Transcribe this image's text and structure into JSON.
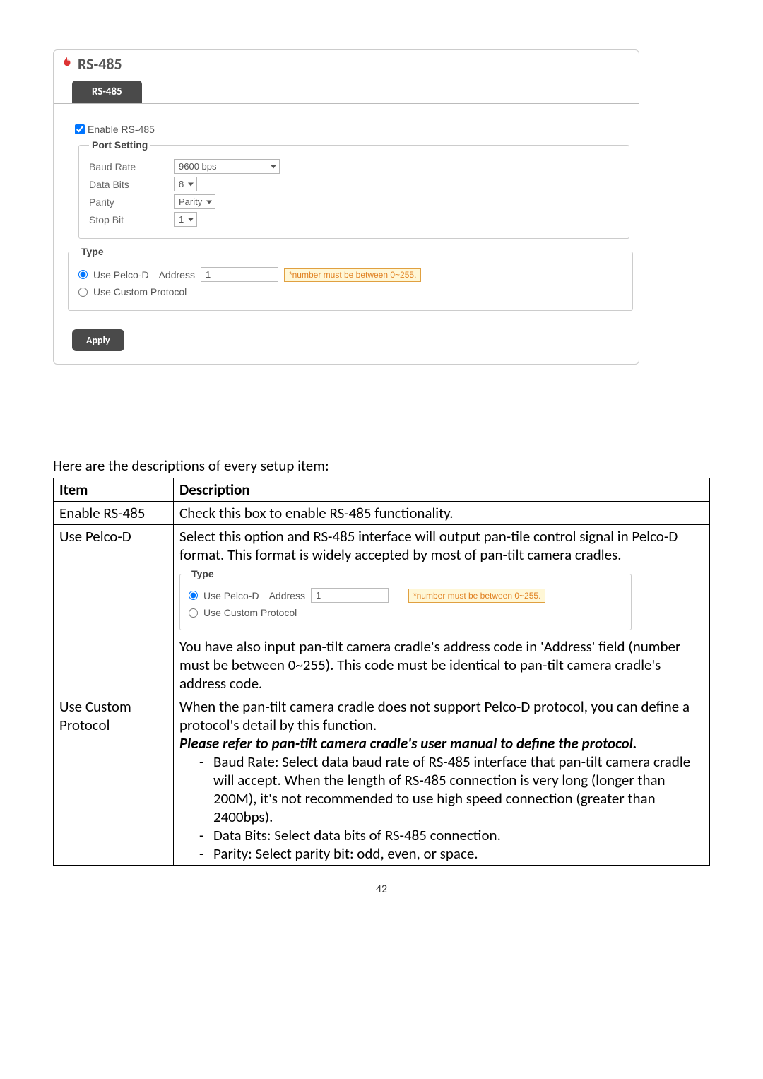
{
  "panel": {
    "title": "RS-485",
    "tab": "RS-485",
    "enable_label": "Enable RS-485",
    "enable_checked": true,
    "port_setting_legend": "Port Setting",
    "baud_rate_label": "Baud Rate",
    "baud_rate_value": "9600 bps",
    "data_bits_label": "Data Bits",
    "data_bits_value": "8",
    "parity_label": "Parity",
    "parity_value": "Parity",
    "stop_bit_label": "Stop Bit",
    "stop_bit_value": "1",
    "type_legend": "Type",
    "pelco_label": "Use Pelco-D",
    "pelco_selected": true,
    "address_label": "Address",
    "address_value": "1",
    "address_warning": "*number must be between 0~255.",
    "custom_label": "Use Custom Protocol",
    "custom_selected": false,
    "apply_label": "Apply"
  },
  "intro_text": "Here are the descriptions of every setup item:",
  "table": {
    "header_item": "Item",
    "header_desc": "Description",
    "rows": {
      "r1_item": "Enable RS-485",
      "r1_desc": "Check this box to enable RS-485 functionality.",
      "r2_item": "Use Pelco-D",
      "r2_p1": "Select this option and RS-485 interface will output pan-tile control signal in Pelco-D format. This format is widely accepted by most of pan-tilt camera cradles.",
      "r2_p2": "You have also input pan-tilt camera cradle's address code in 'Address' field (number must be between 0~255). This code must be identical to pan-tilt camera cradle's address code.",
      "r3_item": "Use Custom Protocol",
      "r3_p1": "When the pan-tilt camera cradle does not support Pelco-D protocol, you can define a protocol's detail by this function.",
      "r3_p2": "Please refer to pan-tilt camera cradle's user manual to define the protocol.",
      "r3_b1": "Baud Rate: Select data baud rate of RS-485 interface that pan-tilt camera cradle will accept. When the length of RS-485 connection is very long (longer than 200M), it's not recommended to use high speed connection (greater than 2400bps).",
      "r3_b2": "Data Bits: Select data bits of RS-485 connection.",
      "r3_b3": "Parity: Select parity bit: odd, even, or space."
    }
  },
  "inner_fieldset": {
    "legend": "Type",
    "pelco_label": "Use Pelco-D",
    "address_label": "Address",
    "address_value": "1",
    "warning": "*number must be between 0~255.",
    "custom_label": "Use Custom Protocol"
  },
  "page_number": "42"
}
